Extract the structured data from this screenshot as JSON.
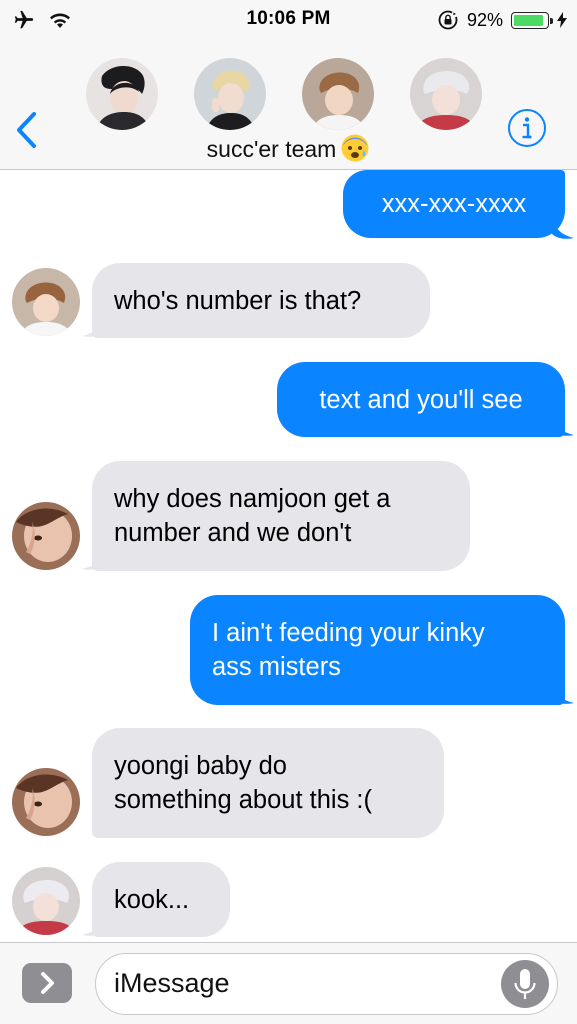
{
  "status_bar": {
    "time": "10:06 PM",
    "battery_percent_label": "92%",
    "battery_level": 0.92,
    "icons": [
      "airplane-icon",
      "wifi-icon",
      "orientation-lock-icon",
      "battery-icon",
      "charging-bolt-icon"
    ]
  },
  "header": {
    "group_name": "succ'er team",
    "group_emoji": "anxious-face-emoji",
    "back_icon": "chevron-left-icon",
    "info_icon": "info-icon",
    "accent_color": "#0b84ff"
  },
  "messages": [
    {
      "direction": "out",
      "lines": [
        "xxx-xxx-xxxx"
      ]
    },
    {
      "direction": "in",
      "lines": [
        "who's number is that?"
      ]
    },
    {
      "direction": "out",
      "lines": [
        "text and you'll see"
      ]
    },
    {
      "direction": "in",
      "lines": [
        "why does namjoon get a",
        "number and we don't"
      ]
    },
    {
      "direction": "out",
      "lines": [
        "I ain't feeding your kinky",
        "ass misters"
      ]
    },
    {
      "direction": "in",
      "lines": [
        "yoongi baby do",
        "something about this :("
      ]
    },
    {
      "direction": "in",
      "lines": [
        "kook..."
      ]
    }
  ],
  "input_bar": {
    "placeholder": "iMessage",
    "apps_icon": "app-drawer-chevron-icon",
    "mic_icon": "microphone-icon"
  },
  "colors": {
    "outgoing_bubble": "#0b84ff",
    "incoming_bubble": "#e5e5ea",
    "bars_background": "#f7f7f7"
  }
}
